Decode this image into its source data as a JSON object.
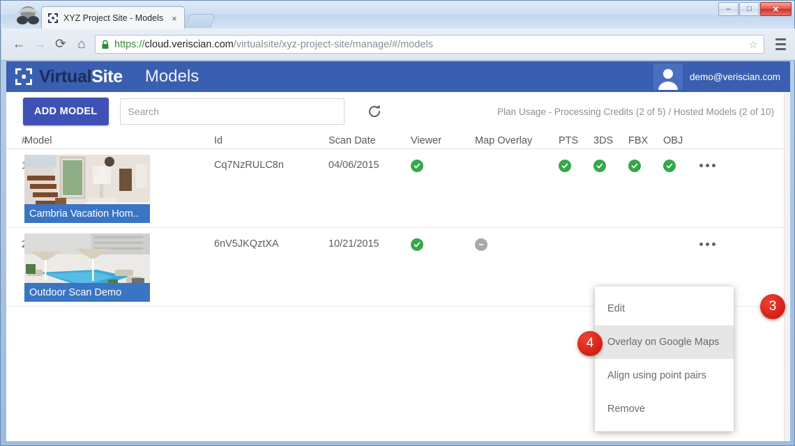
{
  "browser": {
    "tab_title": "XYZ Project Site - Models",
    "tab_close": "×",
    "back_icon": "←",
    "forward_icon": "→",
    "reload_icon": "⟳",
    "home_icon": "⌂",
    "star_icon": "☆",
    "url": {
      "scheme": "https://",
      "host": "cloud.veriscian.com",
      "path": "/virtualsite/xyz-project-site/manage/#/models"
    },
    "window_buttons": {
      "minimize": "–",
      "maximize": "□",
      "close": "✕"
    }
  },
  "app": {
    "brand_first": "Virtual",
    "brand_second": "Site",
    "page_title": "Models",
    "account_email": "demo@veriscian.com",
    "header_bg": "#3a5fb0"
  },
  "toolbar": {
    "add_model_label": "ADD MODEL",
    "search_placeholder": "Search",
    "search_value": "",
    "refresh_title": "Refresh",
    "plan_usage": "Plan Usage - Processing Credits (2 of 5) / Hosted Models (2 of 10)"
  },
  "table": {
    "headers": {
      "num": "#",
      "model": "Model",
      "id": "Id",
      "scan_date": "Scan Date",
      "viewer": "Viewer",
      "map_overlay": "Map Overlay",
      "pts": "PTS",
      "tds": "3DS",
      "fbx": "FBX",
      "obj": "OBJ"
    },
    "rows": [
      {
        "num": "1",
        "name": "Cambria Vacation Hom..",
        "id": "Cq7NzRULC8n",
        "scan_date": "04/06/2015",
        "viewer": "check",
        "map_overlay": "",
        "pts": "check",
        "tds": "check",
        "fbx": "check",
        "obj": "check",
        "actions_icon": "ellipsis-icon"
      },
      {
        "num": "2",
        "name": "Outdoor Scan Demo",
        "id": "6nV5JKQztXA",
        "scan_date": "10/21/2015",
        "viewer": "check",
        "map_overlay": "disabled",
        "pts": "",
        "tds": "",
        "fbx": "",
        "obj": "",
        "actions_icon": "ellipsis-icon"
      }
    ]
  },
  "context_menu": {
    "items": [
      {
        "label": "Edit",
        "active": false
      },
      {
        "label": "Overlay on Google Maps",
        "active": true
      },
      {
        "label": "Align using point pairs",
        "active": false
      },
      {
        "label": "Remove",
        "active": false
      }
    ]
  },
  "annotations": {
    "badge3": "3",
    "badge4": "4",
    "badge_color": "#d41f12"
  }
}
